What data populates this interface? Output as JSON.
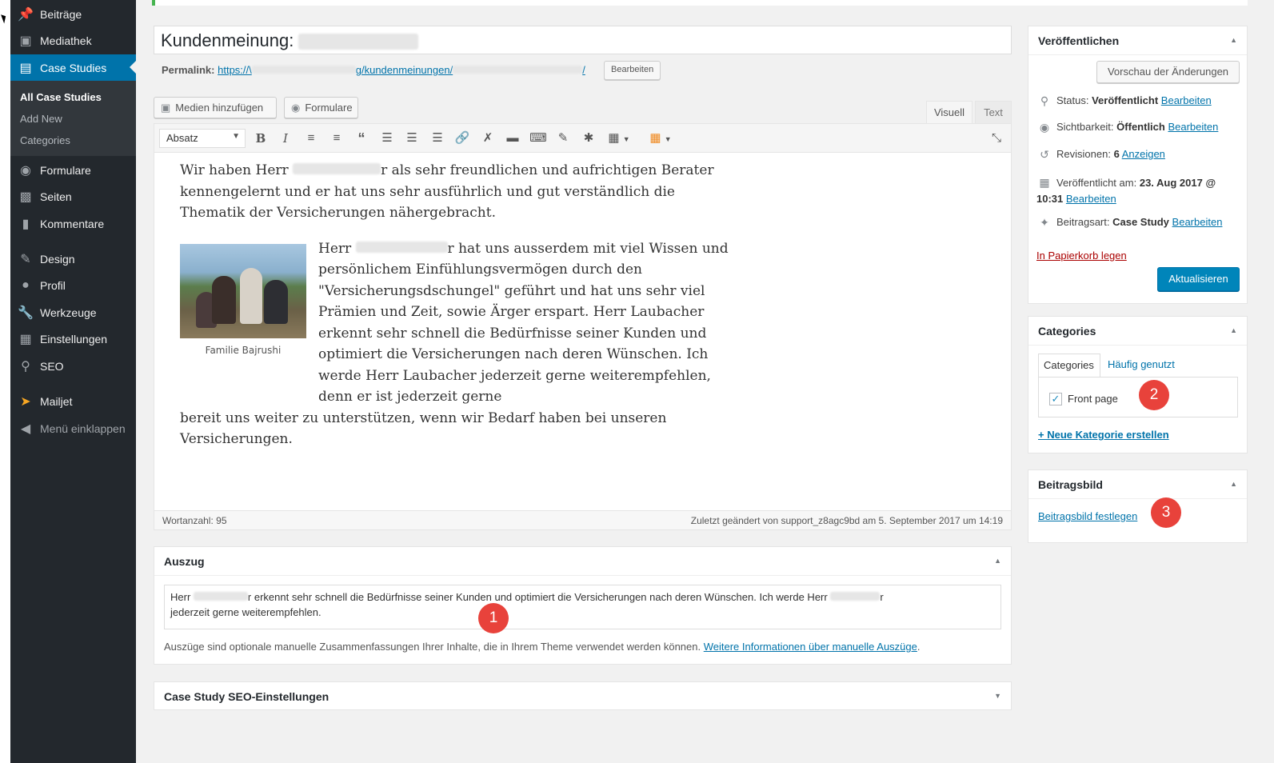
{
  "sidebar": {
    "items": [
      {
        "label": "Beiträge",
        "icon": "pin-icon"
      },
      {
        "label": "Mediathek",
        "icon": "media-icon"
      },
      {
        "label": "Case Studies",
        "icon": "document-icon"
      },
      {
        "label": "Formulare",
        "icon": "form-icon"
      },
      {
        "label": "Seiten",
        "icon": "pages-icon"
      },
      {
        "label": "Kommentare",
        "icon": "comment-icon"
      },
      {
        "label": "Design",
        "icon": "brush-icon"
      },
      {
        "label": "Profil",
        "icon": "user-icon"
      },
      {
        "label": "Werkzeuge",
        "icon": "wrench-icon"
      },
      {
        "label": "Einstellungen",
        "icon": "settings-icon"
      },
      {
        "label": "SEO",
        "icon": "search-icon"
      },
      {
        "label": "Mailjet",
        "icon": "mailjet-icon"
      },
      {
        "label": "Menü einklappen",
        "icon": "collapse-icon"
      }
    ],
    "submenu": [
      "All Case Studies",
      "Add New",
      "Categories"
    ]
  },
  "editor": {
    "title_prefix": "Kundenmeinung:",
    "permalink_label": "Permalink:",
    "permalink_start": "https://\\",
    "permalink_end": "g/kundenmeinungen/",
    "permalink_tail": "/",
    "edit_label": "Bearbeiten",
    "add_media": "Medien hinzufügen",
    "forms": "Formulare",
    "tab_visual": "Visuell",
    "tab_text": "Text",
    "format_select": "Absatz",
    "para1_a": "Wir haben Herr",
    "para1_b": "r als sehr freundlichen und aufrichtigen Berater kennengelernt und er hat uns sehr ausführlich und gut verständlich die Thematik der Versicherungen nähergebracht.",
    "para2_a": "Herr",
    "para2_b": "r hat uns ausserdem mit viel Wissen und persönlichem Einfühlungsvermögen durch den \"Versicherungsdschungel\" geführt und hat uns sehr viel Prämien und Zeit, sowie Ärger erspart. Herr Laubacher erkennt sehr schnell die Bedürfnisse seiner Kunden und optimiert die Versicherungen nach deren Wünschen. Ich werde Herr Laubacher jederzeit gerne weiterempfehlen, denn er ist jederzeit gerne",
    "para2_c": "bereit uns weiter zu unterstützen, wenn wir Bedarf haben bei unseren Versicherungen.",
    "caption": "Familie Bajrushi",
    "word_count": "Wortanzahl: 95",
    "last_modified": "Zuletzt geändert von support_z8agc9bd am 5. September 2017 um 14:19"
  },
  "excerpt": {
    "title": "Auszug",
    "text_a": "Herr",
    "text_b": "r erkennt sehr schnell die Bedürfnisse seiner Kunden und optimiert die Versicherungen nach deren Wünschen. Ich werde Herr",
    "text_c": "r",
    "text_d": "jederzeit gerne weiterempfehlen.",
    "help": "Auszüge sind optionale manuelle Zusammenfassungen Ihrer Inhalte, die in Ihrem Theme verwendet werden können.",
    "help_link": "Weitere Informationen über manuelle Auszüge",
    "help_end": "."
  },
  "seo_box": {
    "title": "Case Study SEO-Einstellungen"
  },
  "publish": {
    "title": "Veröffentlichen",
    "preview": "Vorschau der Änderungen",
    "status_label": "Status:",
    "status_value": "Veröffentlicht",
    "visibility_label": "Sichtbarkeit:",
    "visibility_value": "Öffentlich",
    "revisions_label": "Revisionen:",
    "revisions_value": "6",
    "revisions_link": "Anzeigen",
    "published_label": "Veröffentlicht am:",
    "published_value": "23. Aug 2017 @ 10:31",
    "type_label": "Beitragsart:",
    "type_value": "Case Study",
    "edit": "Bearbeiten",
    "trash": "In Papierkorb legen",
    "update": "Aktualisieren"
  },
  "categories": {
    "title": "Categories",
    "tab_all": "Categories",
    "tab_popular": "Häufig genutzt",
    "item": "Front page",
    "item_checked": true,
    "add_new": "+ Neue Kategorie erstellen"
  },
  "featured": {
    "title": "Beitragsbild",
    "link": "Beitragsbild festlegen"
  },
  "badges": [
    "1",
    "2",
    "3"
  ],
  "colors": {
    "accent": "#0073aa",
    "sidebar": "#23282d",
    "badge": "#e8423b",
    "update_button": "#0085ba"
  }
}
